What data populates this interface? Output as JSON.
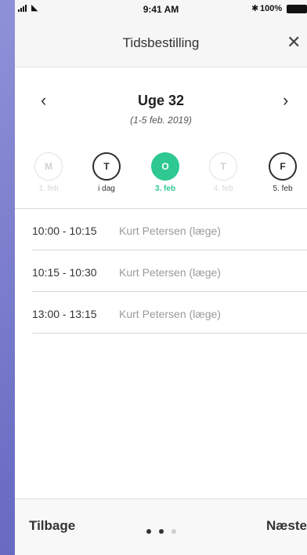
{
  "status_bar": {
    "time": "9:41 AM",
    "battery": "100%"
  },
  "nav": {
    "title": "Tidsbestilling",
    "close_icon": "close-icon"
  },
  "week": {
    "title": "Uge 32",
    "range": "(1-5 feb. 2019)"
  },
  "days": [
    {
      "letter": "M",
      "label": "1. feb",
      "state": "disabled"
    },
    {
      "letter": "T",
      "label": "i dag",
      "state": "normal"
    },
    {
      "letter": "O",
      "label": "3. feb",
      "state": "selected"
    },
    {
      "letter": "T",
      "label": "4. feb",
      "state": "disabled"
    },
    {
      "letter": "F",
      "label": "5. feb",
      "state": "normal"
    }
  ],
  "slots": [
    {
      "time": "10:00 - 10:15",
      "doctor": "Kurt Petersen (læge)"
    },
    {
      "time": "10:15 - 10:30",
      "doctor": "Kurt Petersen (læge)"
    },
    {
      "time": "13:00 - 13:15",
      "doctor": "Kurt Petersen (læge)"
    }
  ],
  "footer": {
    "back": "Tilbage",
    "next": "Næste",
    "pages": 3,
    "current_page": 2
  },
  "colors": {
    "accent": "#2ec891",
    "background": "#7e80cf"
  }
}
